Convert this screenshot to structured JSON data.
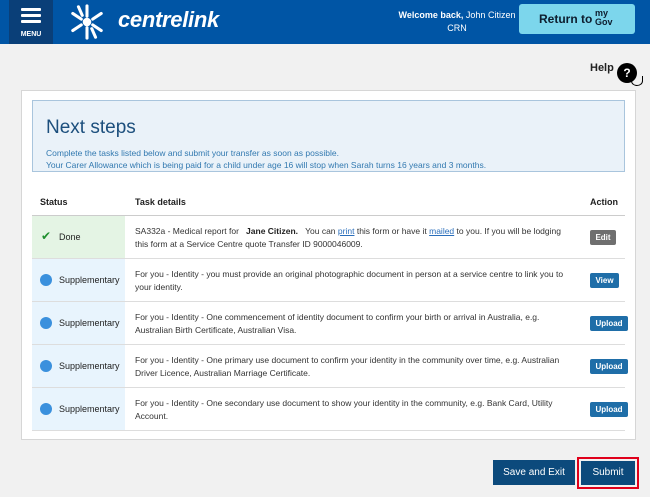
{
  "header": {
    "menu_label": "MENU",
    "logo_text": "centrelink",
    "welcome_line1": "Welcome back,",
    "welcome_name": "John Citizen",
    "welcome_line2": "CRN",
    "mygov_button_label": "Return to",
    "mygov_logo_line1": "my",
    "mygov_logo_line2": "Gov",
    "brand_color": "#0055a5",
    "mygov_color": "#7cd6ec"
  },
  "help": {
    "label": "Help",
    "icon_glyph": "?"
  },
  "next_steps": {
    "title": "Next steps",
    "line1": "Complete the tasks listed below and submit your transfer as soon as possible.",
    "line2": "Your Carer Allowance which is being paid for a child under age 16 will stop when Sarah turns 16 years and 3 months."
  },
  "table": {
    "headers": {
      "status": "Status",
      "task": "Task details",
      "action": "Action"
    },
    "rows": [
      {
        "status": "Done",
        "status_icon": "check-icon",
        "task_prefix": "SA332a - Medical report for",
        "task_name": "Jane Citizen.",
        "task_middle": "You can",
        "link_print": "print",
        "task_or": "this form or have it",
        "link_mailed": "mailed",
        "task_suffix": "to you. If you will be lodging this form at a Service Centre quote Transfer ID 9000046009.",
        "action": "Edit"
      },
      {
        "status": "Supplementary",
        "status_icon": "blue-dot-icon",
        "task": "For you - Identity - you must provide an original photographic document in person at a service centre to link you to your identity.",
        "action": "View"
      },
      {
        "status": "Supplementary",
        "status_icon": "blue-dot-icon",
        "task": "For you - Identity - One commencement of identity document to confirm your birth or arrival in Australia, e.g. Australian Birth Certificate, Australian Visa.",
        "action": "Upload"
      },
      {
        "status": "Supplementary",
        "status_icon": "blue-dot-icon",
        "task": "For you - Identity - One primary use document to confirm your identity in the community over time, e.g. Australian Driver Licence, Australian Marriage Certificate.",
        "action": "Upload"
      },
      {
        "status": "Supplementary",
        "status_icon": "blue-dot-icon",
        "task": "For you - Identity - One secondary use document to show your identity in the community, e.g. Bank Card, Utility Account.",
        "action": "Upload"
      }
    ]
  },
  "footer": {
    "save_exit_label": "Save and Exit",
    "submit_label": "Submit",
    "highlight_color": "#e0001b"
  }
}
